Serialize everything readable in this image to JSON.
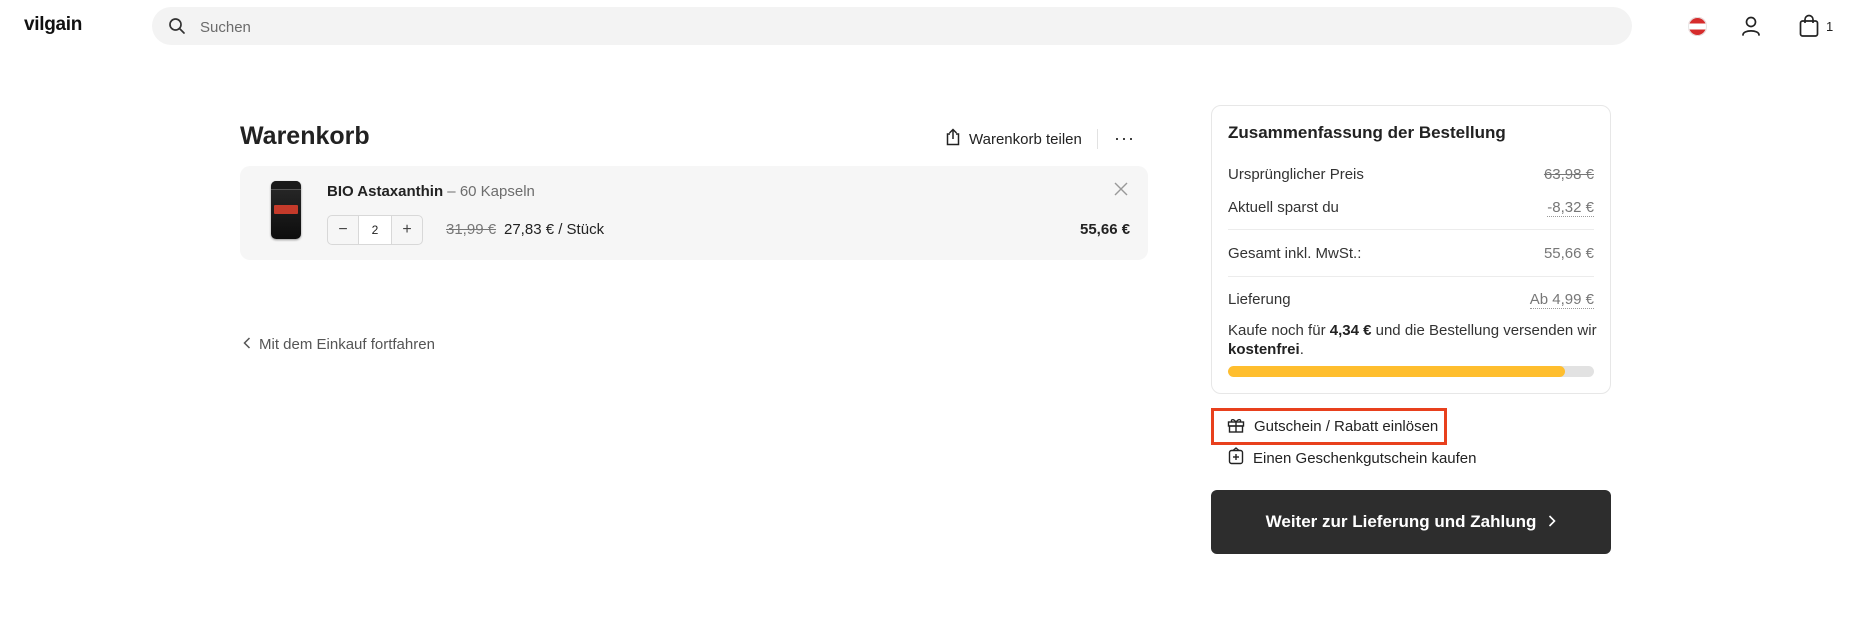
{
  "header": {
    "logo": "vilgain",
    "search_placeholder": "Suchen",
    "cart_count": "1"
  },
  "cart": {
    "title": "Warenkorb",
    "share_label": "Warenkorb teilen",
    "more_label": "···",
    "item": {
      "name": "BIO Astaxanthin",
      "variant": " – 60 Kapseln",
      "quantity": "2",
      "old_price": "31,99 €",
      "unit_price": "27,83 € / Stück",
      "total": "55,66 €"
    },
    "continue_label": "Mit dem Einkauf fortfahren"
  },
  "summary": {
    "title": "Zusammenfassung der Bestellung",
    "original_price_label": "Ursprünglicher Preis",
    "original_price": "63,98 €",
    "savings_label": "Aktuell sparst du",
    "savings": "-8,32 €",
    "total_label": "Gesamt inkl. MwSt.:",
    "total": "55,66 €",
    "delivery_label": "Lieferung",
    "delivery": "Ab 4,99 €",
    "free_shipping": {
      "prefix": "Kaufe noch für ",
      "amount": "4,34 €",
      "middle": " und die Bestellung versenden wir ",
      "highlight": "kostenfrei",
      "suffix": "."
    },
    "free_shipping_progress": 0.92,
    "voucher_label": "Gutschein / Rabatt einlösen",
    "gift_card_label": "Einen Geschenkgutschein kaufen",
    "cta_label": "Weiter zur Lieferung und Zahlung"
  },
  "colors": {
    "accent_highlight": "#e8401d",
    "progress": "#ffbe2e",
    "cta_bg": "#2d2d2d"
  }
}
